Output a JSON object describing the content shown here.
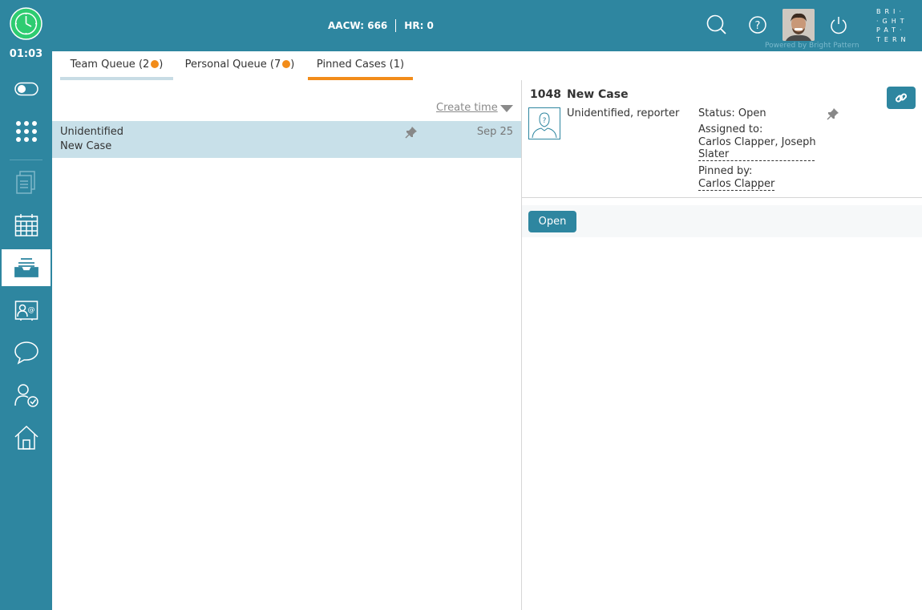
{
  "header": {
    "aacw": "AACW: 666",
    "hr": "HR: 0",
    "powered_by": "Powered by Bright Pattern",
    "brand_lines": [
      "BRI·",
      "·GHT",
      "PAT·",
      "TERN"
    ]
  },
  "sidebar": {
    "timer": "01:03",
    "items": [
      {
        "name": "state-toggle-icon"
      },
      {
        "name": "dialpad-icon"
      },
      {
        "name": "documents-icon"
      },
      {
        "name": "calendar-icon"
      },
      {
        "name": "case-inbox-icon",
        "active": true
      },
      {
        "name": "directory-icon"
      },
      {
        "name": "chat-icon"
      },
      {
        "name": "user-check-icon"
      },
      {
        "name": "home-icon"
      }
    ]
  },
  "tabs": [
    {
      "label": "Team Queue (2",
      "suffix": ")",
      "badge": true
    },
    {
      "label": "Personal Queue (7",
      "suffix": ")",
      "badge": true
    },
    {
      "label": "Pinned Cases (1)",
      "suffix": "",
      "badge": false,
      "active": true
    }
  ],
  "list": {
    "sort_label": "Create time",
    "rows": [
      {
        "name": "Unidentified",
        "subject": "New Case",
        "date": "Sep 25",
        "pinned": true
      }
    ]
  },
  "details": {
    "case_number": "1048",
    "case_title": "New Case",
    "contact": "Unidentified, reporter",
    "status": "Status: Open",
    "assigned_label": "Assigned to:",
    "assigned_line1": "Carlos Clapper, Joseph",
    "assigned_line2": "Slater",
    "pinned_label": "Pinned by:",
    "pinned_by": "Carlos Clapper",
    "open_button": "Open"
  },
  "colors": {
    "primary": "#2e86a0",
    "selected_row": "#c8e0e9",
    "badge": "#f28c1a",
    "clock_green": "#2ecc71"
  }
}
